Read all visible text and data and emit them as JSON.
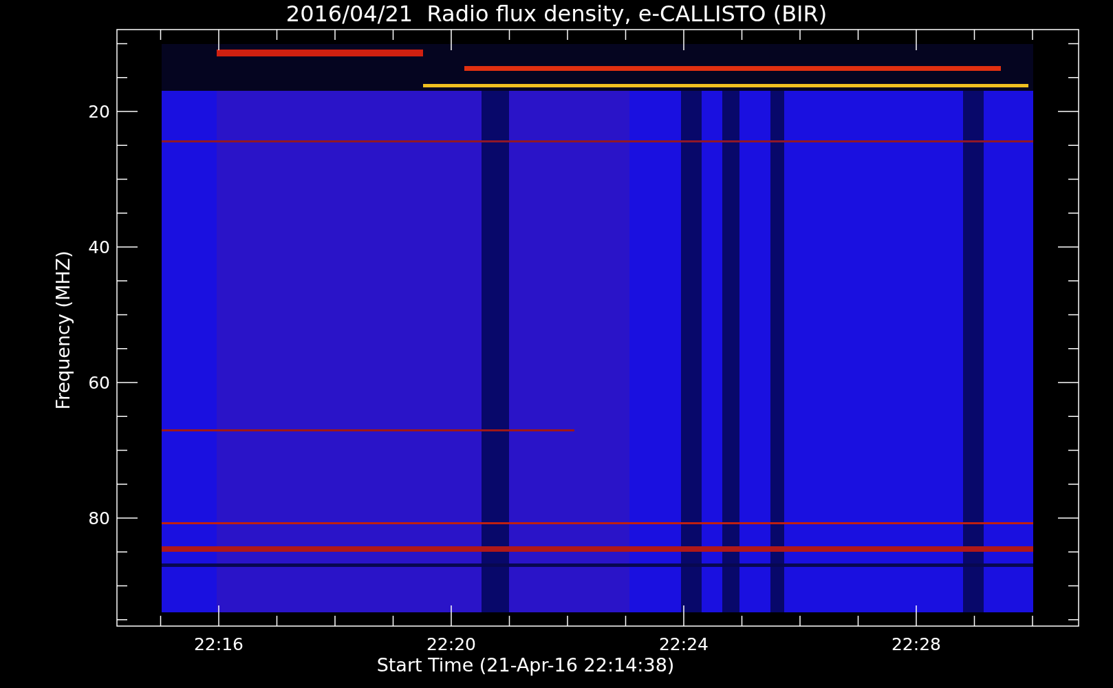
{
  "title": "2016/04/21  Radio flux density, e-CALLISTO (BIR)",
  "xlabel": "Start Time (21-Apr-16 22:14:38)",
  "ylabel": "Frequency (MHZ)",
  "xticks": [
    "22:16",
    "22:20",
    "22:24",
    "22:28"
  ],
  "yticks": [
    "20",
    "40",
    "60",
    "80"
  ]
}
